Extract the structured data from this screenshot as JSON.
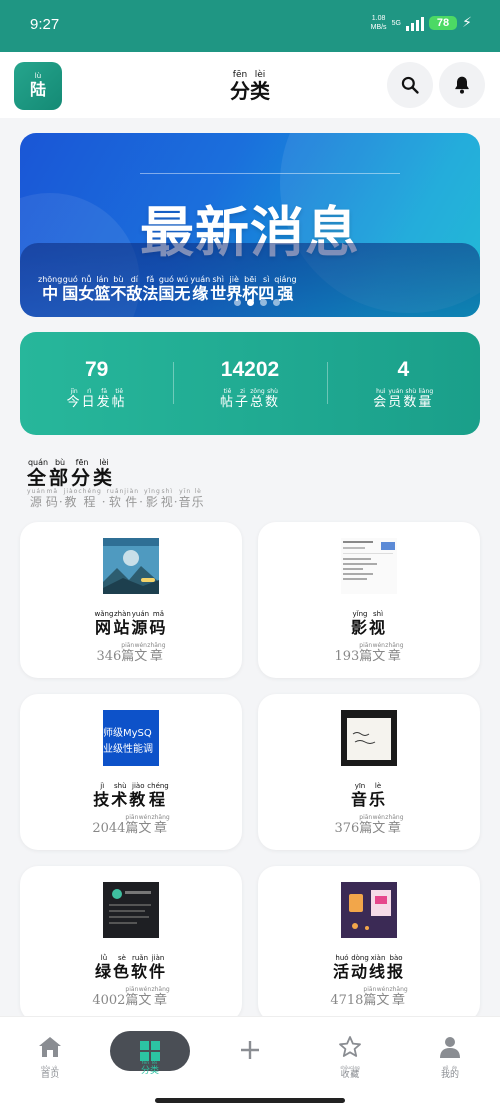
{
  "status_bar": {
    "time": "9:27",
    "net_speed_value": "1.08",
    "net_speed_unit": "MB/s",
    "network": "5G",
    "battery": "78"
  },
  "header": {
    "logo_char": "陆",
    "logo_pinyin": "lù",
    "title": [
      {
        "char": "分",
        "pinyin": "fēn"
      },
      {
        "char": "类",
        "pinyin": "lèi"
      }
    ]
  },
  "banner": {
    "title": "最新消息",
    "caption": [
      {
        "char": "中",
        "pinyin": "zhōng"
      },
      {
        "char": "国",
        "pinyin": "guó"
      },
      {
        "char": "女",
        "pinyin": "nǚ"
      },
      {
        "char": "篮",
        "pinyin": "lán"
      },
      {
        "char": "不",
        "pinyin": "bù"
      },
      {
        "char": "敌",
        "pinyin": "dí"
      },
      {
        "char": "法",
        "pinyin": "fǎ"
      },
      {
        "char": "国",
        "pinyin": "guó"
      },
      {
        "char": "无",
        "pinyin": "wú"
      },
      {
        "char": "缘",
        "pinyin": "yuán"
      },
      {
        "char": "世",
        "pinyin": "shì"
      },
      {
        "char": "界",
        "pinyin": "jiè"
      },
      {
        "char": "杯",
        "pinyin": "bēi"
      },
      {
        "char": "四",
        "pinyin": "sì"
      },
      {
        "char": "强",
        "pinyin": "qiáng"
      }
    ],
    "dots": 4,
    "active_dot": 1
  },
  "stats": [
    {
      "value": "79",
      "label": [
        {
          "char": "今",
          "pinyin": "jīn"
        },
        {
          "char": "日",
          "pinyin": "rì"
        },
        {
          "char": "发",
          "pinyin": "fā"
        },
        {
          "char": "帖",
          "pinyin": "tiě"
        }
      ]
    },
    {
      "value": "14202",
      "label": [
        {
          "char": "帖",
          "pinyin": "tiě"
        },
        {
          "char": "子",
          "pinyin": "zi"
        },
        {
          "char": "总",
          "pinyin": "zǒng"
        },
        {
          "char": "数",
          "pinyin": "shù"
        }
      ]
    },
    {
      "value": "4",
      "label": [
        {
          "char": "会",
          "pinyin": "huì"
        },
        {
          "char": "员",
          "pinyin": "yuán"
        },
        {
          "char": "数",
          "pinyin": "shù"
        },
        {
          "char": "量",
          "pinyin": "liàng"
        }
      ]
    }
  ],
  "section": {
    "title": [
      {
        "char": "全",
        "pinyin": "quán"
      },
      {
        "char": "部",
        "pinyin": "bù"
      },
      {
        "char": "分",
        "pinyin": "fēn"
      },
      {
        "char": "类",
        "pinyin": "lèi"
      }
    ],
    "subtitle": [
      {
        "char": "源",
        "pinyin": "yuán"
      },
      {
        "char": "码",
        "pinyin": "mǎ"
      },
      {
        "char": "·",
        "pinyin": ""
      },
      {
        "char": "教",
        "pinyin": "jiào"
      },
      {
        "char": "程",
        "pinyin": "chéng"
      },
      {
        "char": "·",
        "pinyin": ""
      },
      {
        "char": "软",
        "pinyin": "ruǎn"
      },
      {
        "char": "件",
        "pinyin": "jiàn"
      },
      {
        "char": "·",
        "pinyin": ""
      },
      {
        "char": "影",
        "pinyin": "yǐng"
      },
      {
        "char": "视",
        "pinyin": "shì"
      },
      {
        "char": "·",
        "pinyin": ""
      },
      {
        "char": "音",
        "pinyin": "yīn"
      },
      {
        "char": "乐",
        "pinyin": "lè"
      }
    ]
  },
  "count_suffix": [
    {
      "char": "篇",
      "pinyin": "piān"
    },
    {
      "char": "文",
      "pinyin": "wén"
    },
    {
      "char": "章",
      "pinyin": "zhāng"
    }
  ],
  "categories": [
    {
      "id": "website-source",
      "count": "346",
      "name": [
        {
          "char": "网",
          "pinyin": "wǎng"
        },
        {
          "char": "站",
          "pinyin": "zhàn"
        },
        {
          "char": "源",
          "pinyin": "yuán"
        },
        {
          "char": "码",
          "pinyin": "mǎ"
        }
      ],
      "thumb": "landscape"
    },
    {
      "id": "video",
      "count": "193",
      "name": [
        {
          "char": "影",
          "pinyin": "yǐng"
        },
        {
          "char": "视",
          "pinyin": "shì"
        }
      ],
      "thumb": "document"
    },
    {
      "id": "tutorial",
      "count": "2044",
      "name": [
        {
          "char": "技",
          "pinyin": "jì"
        },
        {
          "char": "术",
          "pinyin": "shù"
        },
        {
          "char": "教",
          "pinyin": "jiào"
        },
        {
          "char": "程",
          "pinyin": "chéng"
        }
      ],
      "thumb": "mysql",
      "thumb_text_1": "师级MySQ",
      "thumb_text_2": "业级性能调"
    },
    {
      "id": "music",
      "count": "376",
      "name": [
        {
          "char": "音",
          "pinyin": "yīn"
        },
        {
          "char": "乐",
          "pinyin": "lè"
        }
      ],
      "thumb": "notebook"
    },
    {
      "id": "software",
      "count": "4002",
      "name": [
        {
          "char": "绿",
          "pinyin": "lǜ"
        },
        {
          "char": "色",
          "pinyin": "sè"
        },
        {
          "char": "软",
          "pinyin": "ruǎn"
        },
        {
          "char": "件",
          "pinyin": "jiàn"
        }
      ],
      "thumb": "dark-app"
    },
    {
      "id": "events",
      "count": "4718",
      "name": [
        {
          "char": "活",
          "pinyin": "huó"
        },
        {
          "char": "动",
          "pinyin": "dòng"
        },
        {
          "char": "线",
          "pinyin": "xiàn"
        },
        {
          "char": "报",
          "pinyin": "bào"
        }
      ],
      "thumb": "lanterns"
    }
  ],
  "bottom_nav": [
    {
      "id": "home",
      "icon": "home-icon",
      "label": [
        {
          "char": "首",
          "pinyin": "shǒu"
        },
        {
          "char": "页",
          "pinyin": "yè"
        }
      ]
    },
    {
      "id": "category",
      "icon": "grid-icon",
      "label": [
        {
          "char": "分",
          "pinyin": "fēn"
        },
        {
          "char": "类",
          "pinyin": "lèi"
        }
      ],
      "active": true
    },
    {
      "id": "post",
      "icon": "plus-icon",
      "label": []
    },
    {
      "id": "favorites",
      "icon": "star-icon",
      "label": [
        {
          "char": "收",
          "pinyin": "shōu"
        },
        {
          "char": "藏",
          "pinyin": "cáng"
        }
      ]
    },
    {
      "id": "mine",
      "icon": "user-icon",
      "label": [
        {
          "char": "我",
          "pinyin": "wǒ"
        },
        {
          "char": "的",
          "pinyin": "de"
        }
      ]
    }
  ],
  "colors": {
    "primary": "#1f9683",
    "accent": "#2cc3a3",
    "banner_start": "#1a56d6",
    "banner_end": "#10b5d2",
    "nav_active_bg": "#4a4e55"
  }
}
